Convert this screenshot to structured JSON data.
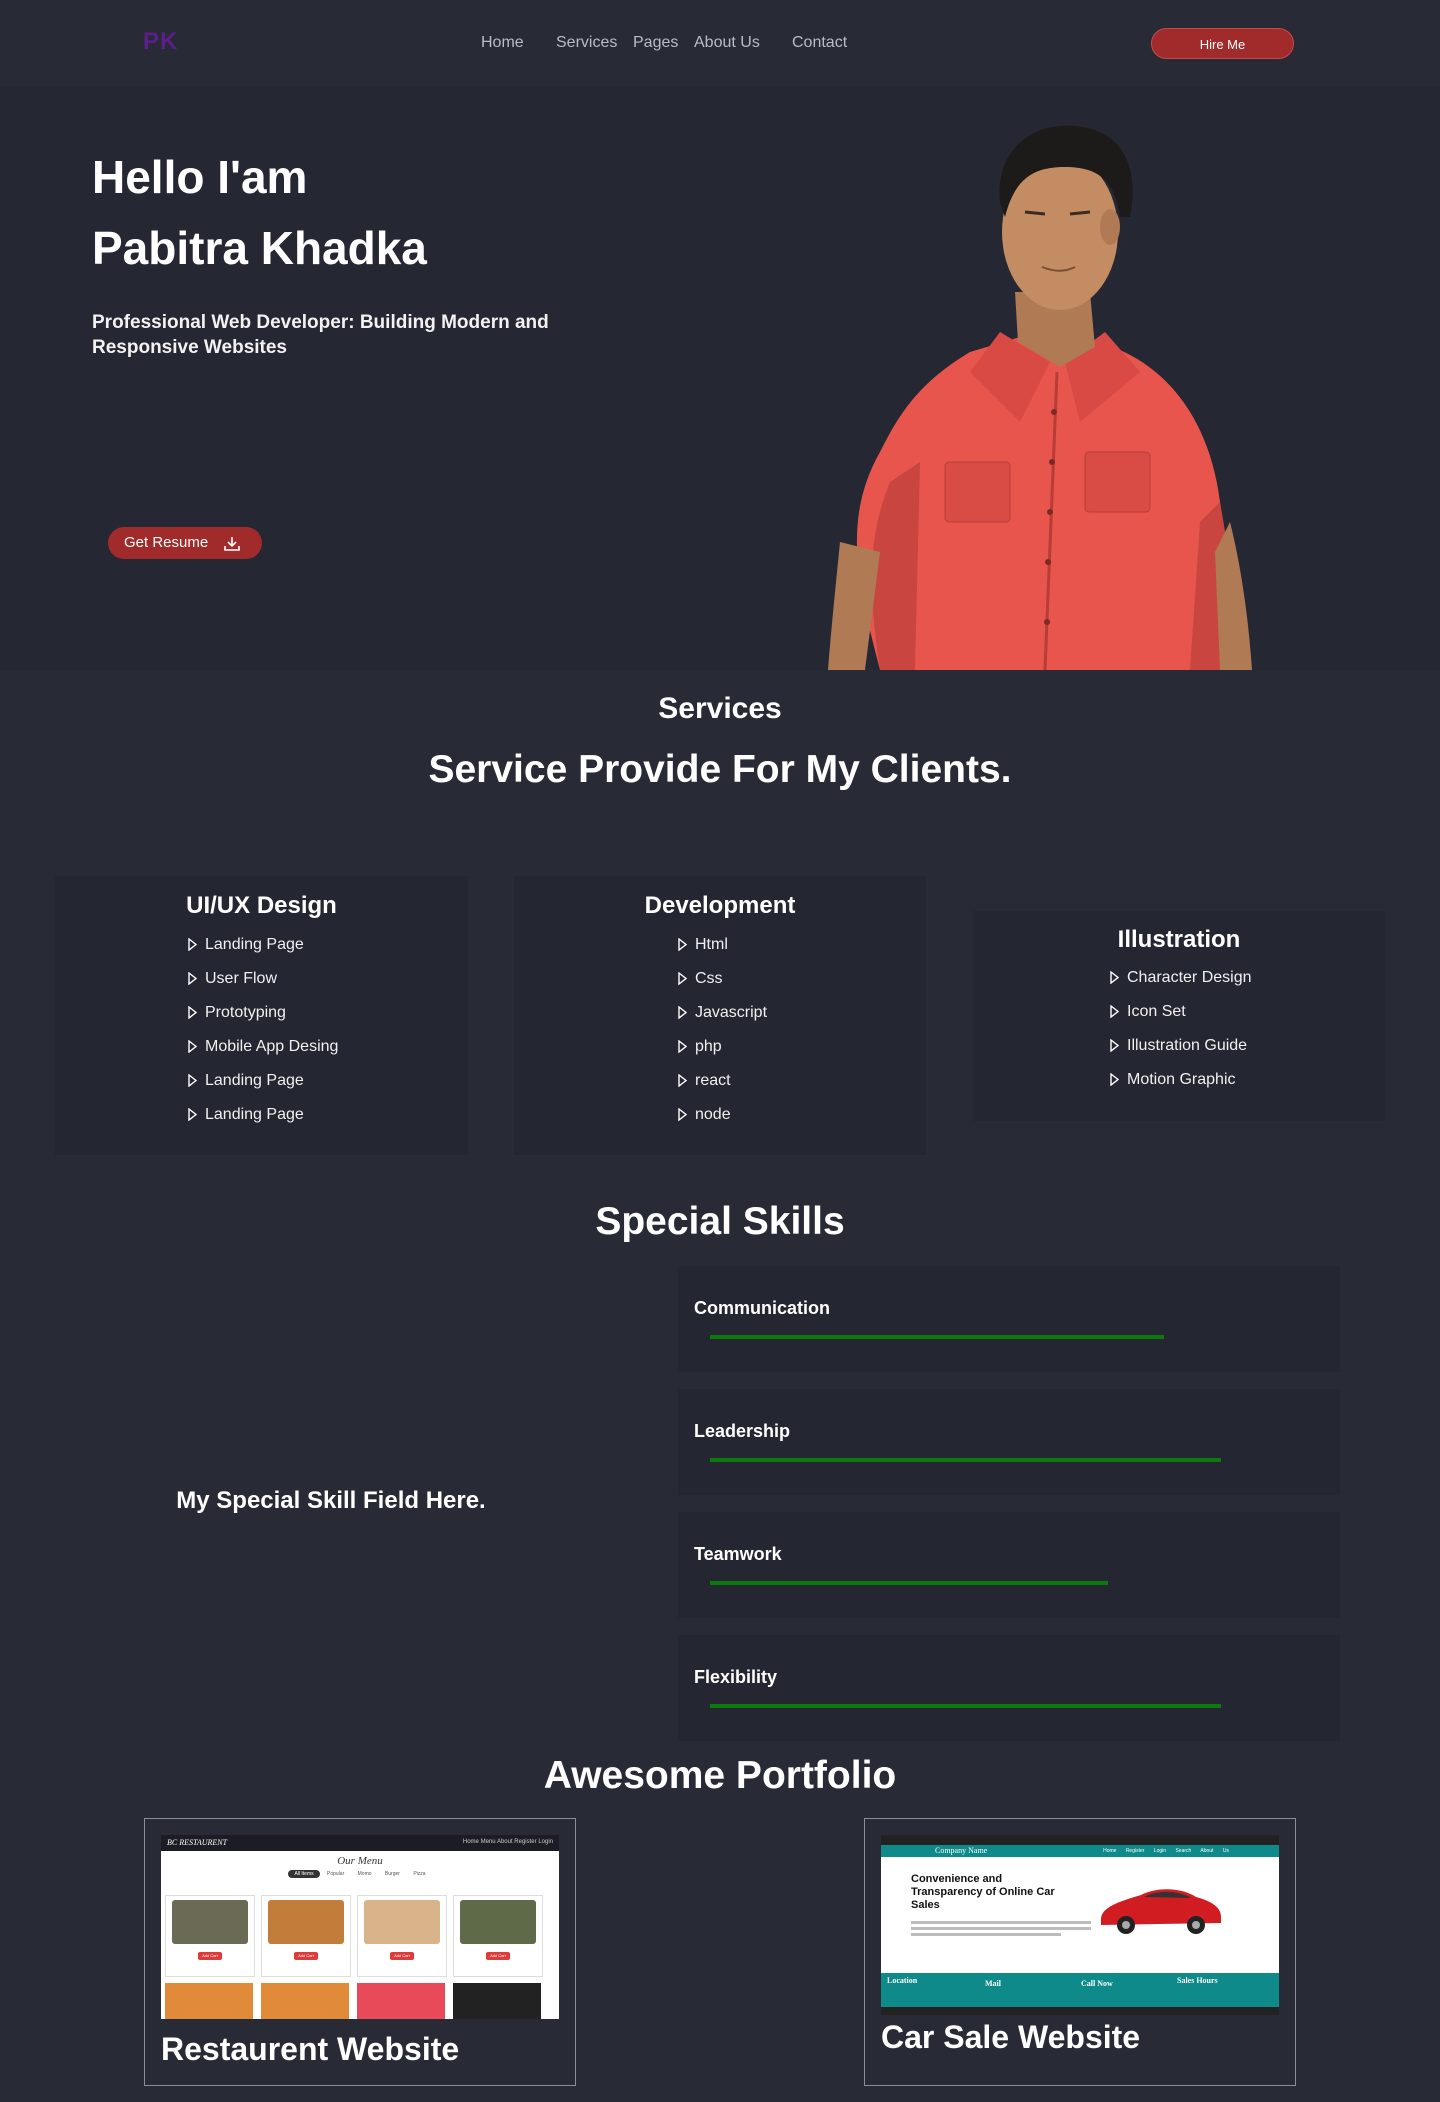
{
  "nav": {
    "logo": "PK",
    "links": [
      "Home",
      "Services",
      "Pages",
      "About Us",
      "Contact"
    ],
    "hire_label": "Hire Me"
  },
  "hero": {
    "line1": "Hello I'am",
    "line2": "Pabitra Khadka",
    "subtitle": "Professional Web Developer: Building Modern and Responsive Websites",
    "resume_label": "Get Resume",
    "portrait_alt": "portrait"
  },
  "services": {
    "label": "Services",
    "title": "Service Provide For My Clients.",
    "cards": [
      {
        "title": "UI/UX Design",
        "items": [
          "Landing Page",
          "User Flow",
          "Prototyping",
          "Mobile App Desing",
          "Landing Page",
          "Landing Page"
        ]
      },
      {
        "title": "Development",
        "items": [
          "Html",
          "Css",
          "Javascript",
          "php",
          "react",
          "node"
        ]
      },
      {
        "title": "Illustration",
        "items": [
          "Character Design",
          "Icon Set",
          "Illustration Guide",
          "Motion Graphic"
        ]
      }
    ]
  },
  "skills": {
    "title": "Special Skills",
    "side_text": "My Special Skill Field Here.",
    "items": [
      {
        "name": "Communication",
        "level": 0.8
      },
      {
        "name": "Leadership",
        "level": 0.9
      },
      {
        "name": "Teamwork",
        "level": 0.7
      },
      {
        "name": "Flexibility",
        "level": 0.9
      }
    ],
    "bar_color": "#0c7a0c"
  },
  "portfolio": {
    "title": "Awesome Portfolio",
    "items": [
      {
        "name": "Restaurent Website",
        "shot": {
          "brand": "BC RESTAURENT",
          "menu_title": "Our Menu",
          "nav": [
            "Home",
            "Menu",
            "About",
            "Register",
            "Login"
          ],
          "tabs": [
            "All Items",
            "Popular",
            "Momo",
            "Burger",
            "Pizza"
          ],
          "button": "Add Cart"
        }
      },
      {
        "name": "Car Sale Website",
        "shot": {
          "company": "Company Name",
          "nav": [
            "Home",
            "Register",
            "Login",
            "Search",
            "About Us"
          ],
          "headline": "Convenience and Transparency of Online Car Sales",
          "footer": [
            "Location",
            "Mail",
            "Call Now",
            "Sales Hours"
          ]
        }
      }
    ]
  },
  "colors": {
    "accent": "#a12b2b",
    "bg": "#282a36",
    "card": "#242632",
    "logo": "#5b1f8a"
  }
}
